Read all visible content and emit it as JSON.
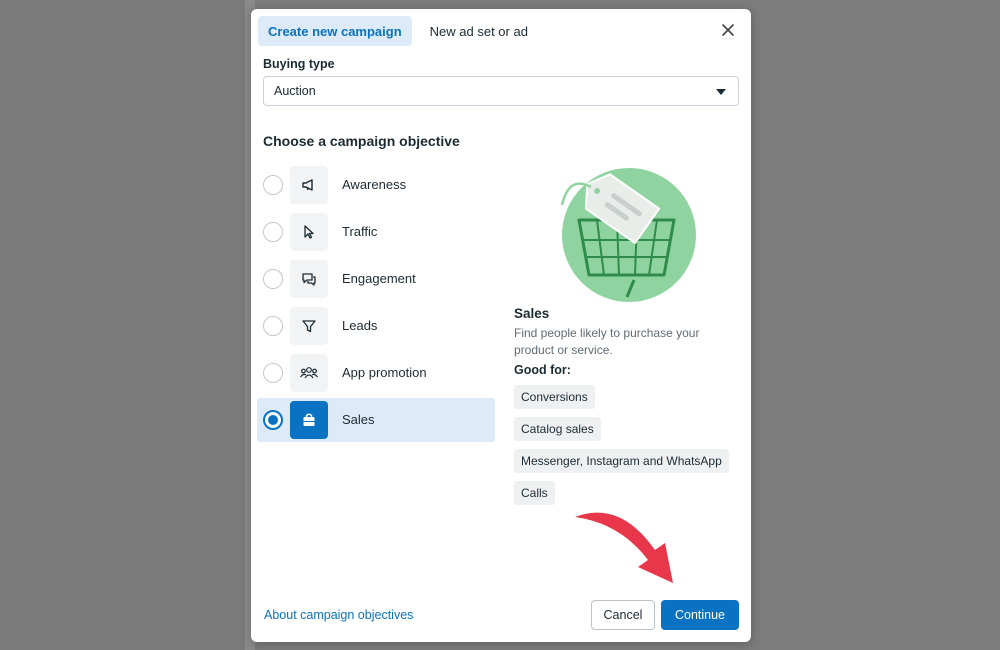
{
  "tabs": [
    {
      "label": "Create new campaign",
      "active": true
    },
    {
      "label": "New ad set or ad",
      "active": false
    }
  ],
  "buying_type": {
    "label": "Buying type",
    "value": "Auction"
  },
  "objective": {
    "title": "Choose a campaign objective",
    "options": [
      {
        "label": "Awareness",
        "icon": "megaphone-icon",
        "selected": false
      },
      {
        "label": "Traffic",
        "icon": "cursor-icon",
        "selected": false
      },
      {
        "label": "Engagement",
        "icon": "chat-bubbles-icon",
        "selected": false
      },
      {
        "label": "Leads",
        "icon": "filter-icon",
        "selected": false
      },
      {
        "label": "App promotion",
        "icon": "people-icon",
        "selected": false
      },
      {
        "label": "Sales",
        "icon": "shopping-bag-icon",
        "selected": true
      }
    ]
  },
  "detail": {
    "title": "Sales",
    "description": "Find people likely to purchase your product or service.",
    "good_for_label": "Good for:",
    "good_for": [
      "Conversions",
      "Catalog sales",
      "Messenger, Instagram and WhatsApp",
      "Calls"
    ]
  },
  "footer": {
    "about_link": "About campaign objectives",
    "cancel": "Cancel",
    "continue": "Continue"
  },
  "colors": {
    "accent": "#0a72c2",
    "selected_bg": "#dcebf7",
    "illustration_green": "#8fd4a0",
    "arrow_red": "#e8374a"
  }
}
